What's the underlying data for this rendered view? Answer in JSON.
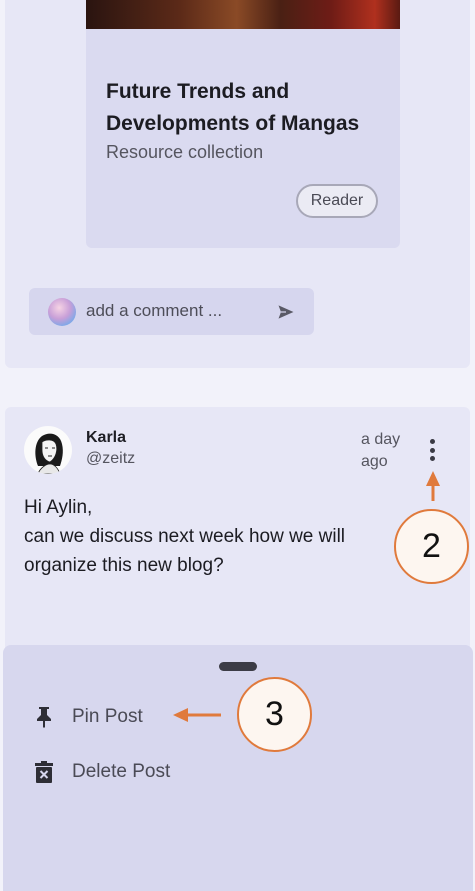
{
  "resource_card": {
    "title": "Future Trends and Developments of Mangas",
    "subtitle": "Resource collection",
    "chip_label": "Reader"
  },
  "comment": {
    "placeholder": "add a comment ..."
  },
  "post": {
    "author_name": "Karla",
    "author_handle": "@zeitz",
    "time_ago": "a day ago",
    "body_line1": "Hi Aylin,",
    "body_line2": "can we discuss next week how we will",
    "body_line3": "organize this new blog?"
  },
  "sheet": {
    "pin_label": "Pin Post",
    "delete_label": "Delete Post"
  },
  "annotations": {
    "callout_2": "2",
    "callout_3": "3"
  },
  "colors": {
    "annotation": "#e07a3c",
    "card_bg": "#e7e7f6",
    "sheet_bg": "#d7d7ee"
  },
  "icons": [
    "send-icon",
    "kebab-menu-icon",
    "pin-icon",
    "delete-icon",
    "drag-handle"
  ]
}
